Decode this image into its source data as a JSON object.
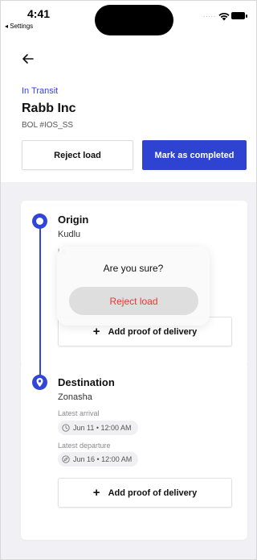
{
  "status_bar": {
    "time": "4:41",
    "back_app": "◂ Settings",
    "signal_dots": "....."
  },
  "header": {
    "status": "In Transit",
    "company": "Rabb Inc",
    "bol": "BOL #IOS_SS"
  },
  "actions": {
    "reject_label": "Reject load",
    "complete_label": "Mark as completed"
  },
  "origin": {
    "title": "Origin",
    "location": "Kudlu",
    "peek_label": "La",
    "proof_label": "Add proof of delivery"
  },
  "destination": {
    "title": "Destination",
    "location": "Zonasha",
    "arrival_label": "Latest arrival",
    "arrival_value": "Jun 11 • 12:00 AM",
    "departure_label": "Latest departure",
    "departure_value": "Jun 16 • 12:00 AM",
    "proof_label": "Add proof of delivery"
  },
  "modal": {
    "title": "Are you sure?",
    "confirm_label": "Reject load"
  },
  "colors": {
    "accent": "#2f43d3",
    "status": "#3443d6",
    "danger": "#e53935",
    "background": "#f1f1f5"
  },
  "icons": {
    "back": "arrow-left-icon",
    "origin_node": "circle-node-icon",
    "destination_node": "map-pin-icon",
    "arrival": "clock-icon",
    "departure": "compass-icon",
    "add": "plus-icon"
  }
}
